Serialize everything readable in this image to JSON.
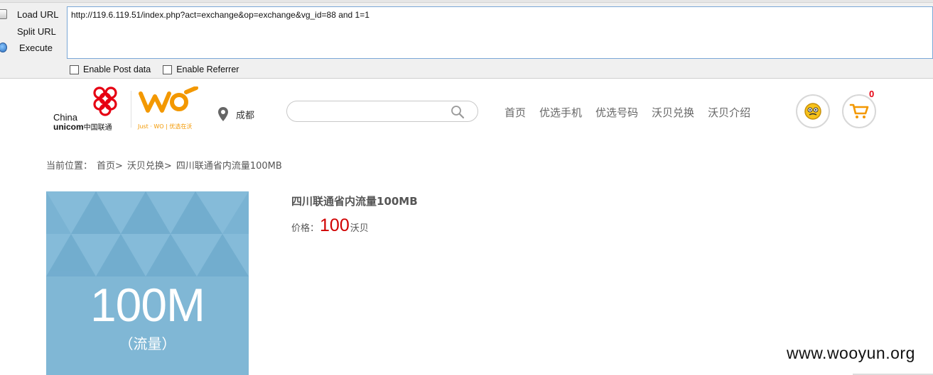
{
  "hackbar": {
    "load_url": "Load URL",
    "split_url": "Split URL",
    "execute": "Execute",
    "url_value": "http://119.6.119.51/index.php?act=exchange&op=exchange&vg_id=88 and 1=1",
    "enable_post": "Enable Post data",
    "enable_referrer": "Enable Referrer"
  },
  "header": {
    "logo_china": "China",
    "logo_unicom": "unicom",
    "logo_cn": "中国联通",
    "logo_tagline": "Just · WO | 优选在沃",
    "location": "成都",
    "nav": [
      "首页",
      "优选手机",
      "优选号码",
      "沃贝兑换",
      "沃贝介绍"
    ],
    "cart_count": "0",
    "icons": [
      "location-pin-icon",
      "search-icon",
      "face-icon",
      "cart-icon"
    ]
  },
  "breadcrumb": {
    "label": "当前位置：",
    "items": [
      "首页>",
      "沃贝兑换>",
      "四川联通省内流量100MB"
    ]
  },
  "product": {
    "image_big": "100M",
    "image_sub": "（流量）",
    "title": "四川联通省内流量100MB",
    "price_label": "价格：",
    "price_value": "100",
    "price_unit": "沃贝"
  },
  "watermark": "www.wooyun.org",
  "colors": {
    "price": "#d00000",
    "cart_badge": "#e60012",
    "logo_red": "#e60012",
    "logo_orange": "#f39800",
    "image_bg": "#7ab3d3"
  }
}
